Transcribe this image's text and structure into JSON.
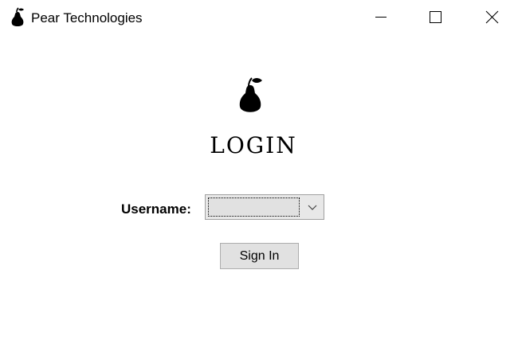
{
  "window": {
    "title": "Pear Technologies",
    "app_icon": "pear-icon",
    "controls": {
      "minimize_icon": "minimize-icon",
      "maximize_icon": "maximize-icon",
      "close_icon": "close-icon"
    }
  },
  "login": {
    "logo_icon": "pear-icon",
    "heading": "LOGIN",
    "username_label": "Username:",
    "username_value": "",
    "dropdown_icon": "chevron-down-icon",
    "signin_label": "Sign In"
  },
  "colors": {
    "background": "#ffffff",
    "text": "#000000",
    "control_face": "#e1e1e1",
    "control_border": "#adadad"
  }
}
